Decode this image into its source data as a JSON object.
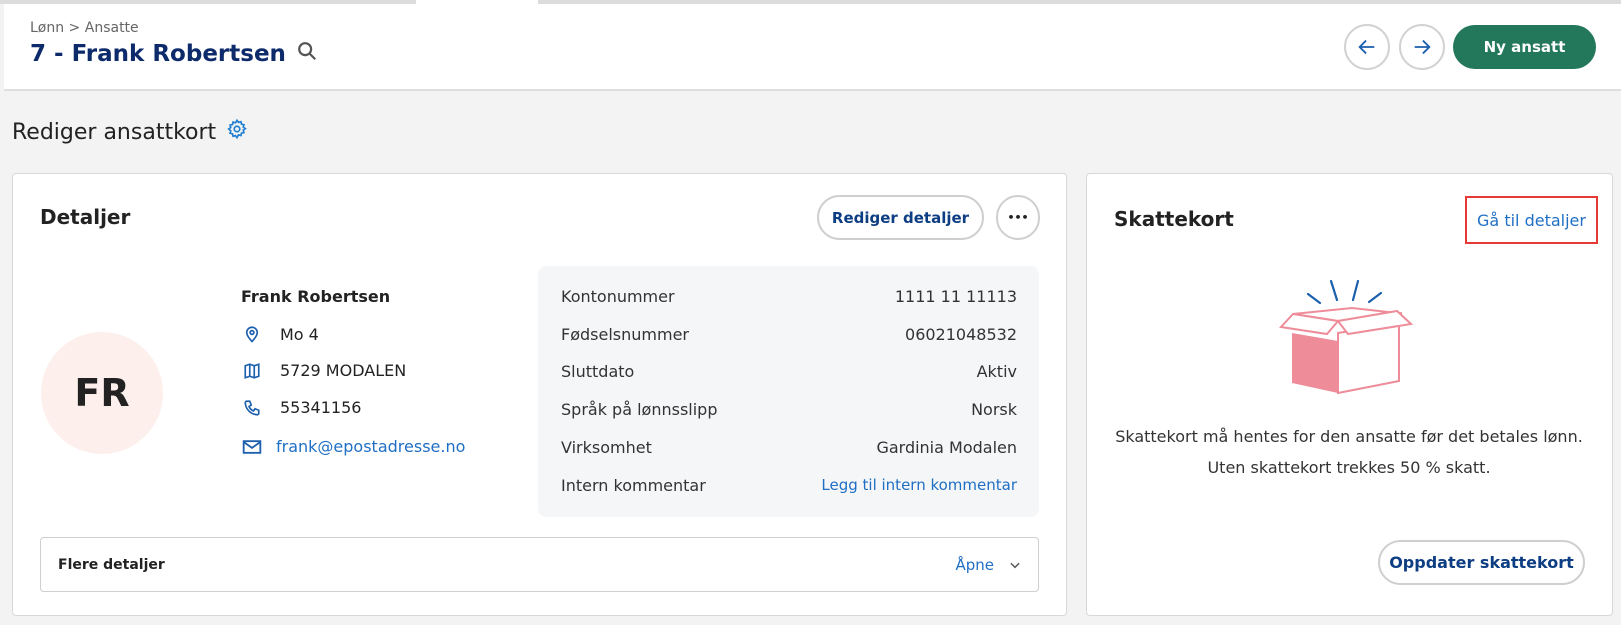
{
  "header": {
    "breadcrumb": "Lønn > Ansatte",
    "title": "7 - Frank Robertsen",
    "new_button": "Ny ansatt"
  },
  "page": {
    "title": "Rediger ansattkort"
  },
  "details": {
    "heading": "Detaljer",
    "edit_button": "Rediger detaljer",
    "more_button": "•••",
    "initials": "FR",
    "name": "Frank Robertsen",
    "address": "Mo 4",
    "postal": "5729 MODALEN",
    "phone": "55341156",
    "email": "frank@epostadresse.no",
    "fields": [
      {
        "label": "Kontonummer",
        "value": "1111 11 11113"
      },
      {
        "label": "Fødselsnummer",
        "value": "06021048532"
      },
      {
        "label": "Sluttdato",
        "value": "Aktiv"
      },
      {
        "label": "Språk på lønnsslipp",
        "value": "Norsk"
      },
      {
        "label": "Virksomhet",
        "value": "Gardinia Modalen"
      },
      {
        "label": "Intern kommentar",
        "value": "Legg til intern kommentar"
      }
    ],
    "more": {
      "label": "Flere detaljer",
      "open": "Åpne"
    }
  },
  "taxcard": {
    "heading": "Skattekort",
    "details_link": "Gå til detaljer",
    "message": "Skattekort må hentes for den ansatte før det betales lønn. Uten skattekort trekkes 50 % skatt.",
    "update_button": "Oppdater skattekort"
  },
  "colors": {
    "primary": "#23775a",
    "link": "#1f6fc5",
    "title": "#0d2a6b",
    "highlight": "#e53935",
    "box": "#ee8c99"
  }
}
